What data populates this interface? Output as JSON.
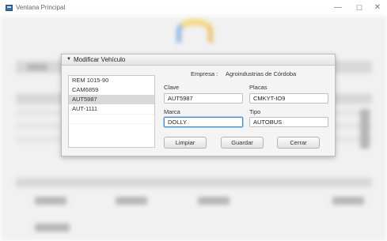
{
  "window": {
    "title": "Ventana Principal",
    "min_glyph": "—",
    "max_glyph": "☐",
    "close_glyph": "✕"
  },
  "dialog": {
    "title": "Modificar Vehículo",
    "caret": "▼",
    "empresa_label": "Empresa :",
    "empresa_value": "Agroindustrias de Córdoba",
    "list": {
      "items": [
        "REM 1015-90",
        "CAM6859",
        "AUT5987",
        "AUT-1111"
      ],
      "selected_index": 2
    },
    "fields": {
      "clave": {
        "label": "Clave",
        "value": "AUT5987"
      },
      "placas": {
        "label": "Placas",
        "value": "CMKYT-IO9"
      },
      "marca": {
        "label": "Marca",
        "value": "DOLLY"
      },
      "tipo": {
        "label": "Tipo",
        "value": "AUTOBUS"
      }
    },
    "buttons": {
      "limpiar": "Limpiar",
      "guardar": "Guardar",
      "cerrar": "Cerrar"
    }
  },
  "colors": {
    "focus_border": "#3c8fd6",
    "selected_row": "#d9d9d9",
    "app_icon": "#3a6fb0"
  }
}
